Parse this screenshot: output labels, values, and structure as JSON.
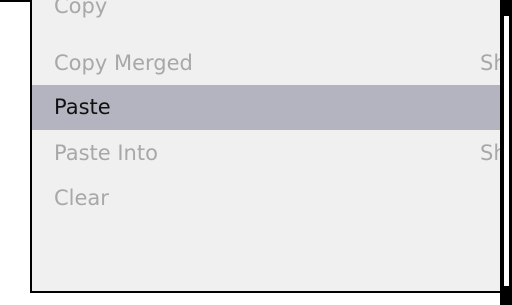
{
  "menu": {
    "items": [
      {
        "label": "Copy",
        "shortcut": "",
        "enabled": false,
        "highlighted": false
      },
      {
        "label": "Copy Merged",
        "shortcut": "Shi",
        "enabled": false,
        "highlighted": false
      },
      {
        "label": "Paste",
        "shortcut": "",
        "enabled": true,
        "highlighted": true
      },
      {
        "label": "Paste Into",
        "shortcut": "Sh",
        "enabled": false,
        "highlighted": false
      },
      {
        "label": "Clear",
        "shortcut": "",
        "enabled": false,
        "highlighted": false
      }
    ]
  },
  "colors": {
    "menu_background": "#f0f0f0",
    "highlight": "#b4b4c0",
    "disabled_text": "#a8a8a8",
    "border": "#000000"
  }
}
